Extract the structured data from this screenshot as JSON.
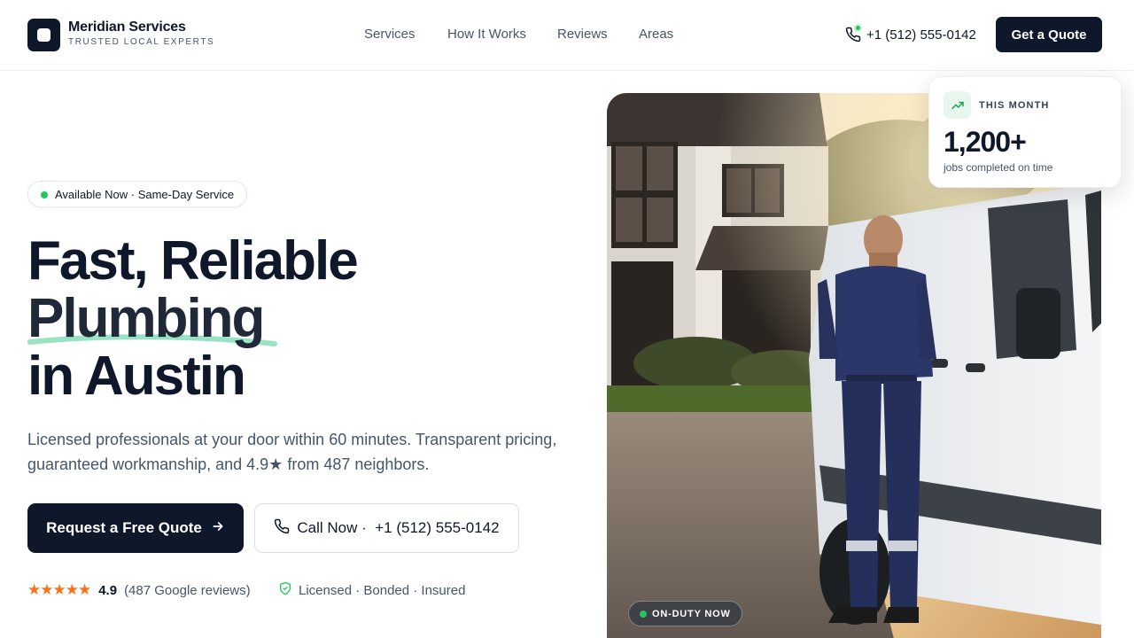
{
  "brand": {
    "name": "Meridian Services",
    "tagline": "TRUSTED LOCAL EXPERTS"
  },
  "nav": {
    "items": [
      {
        "label": "Services"
      },
      {
        "label": "How It Works"
      },
      {
        "label": "Reviews"
      },
      {
        "label": "Areas"
      }
    ]
  },
  "header": {
    "phone": "+1 (512) 555-0142",
    "quote_label": "Get a Quote"
  },
  "hero": {
    "badge": "Available Now · Same-Day Service",
    "title_line1": "Fast, Reliable",
    "title_line2": "Plumbing",
    "title_line3": "in Austin",
    "subtitle": "Licensed professionals at your door within 60 minutes. Transparent pricing, guaranteed workmanship, and 4.9★ from 487 neighbors.",
    "cta_primary": "Request a Free Quote",
    "cta_call": "Call Now ·  +1 (512) 555-0142",
    "rating_score": "4.9",
    "rating_count": "(487 Google reviews)",
    "license": "Licensed · Bonded · Insured"
  },
  "stat_card": {
    "label": "THIS MONTH",
    "value": "1,200+",
    "desc": "jobs completed on time"
  },
  "photo": {
    "badge": "ON-DUTY NOW"
  },
  "colors": {
    "primary": "#0f172a",
    "accent_green": "#22c55e",
    "star": "#f97316",
    "underline": "#99e2c4"
  },
  "icons": [
    "phone-icon",
    "arrow-right-icon",
    "shield-check-icon",
    "trend-up-icon",
    "star-icon"
  ]
}
